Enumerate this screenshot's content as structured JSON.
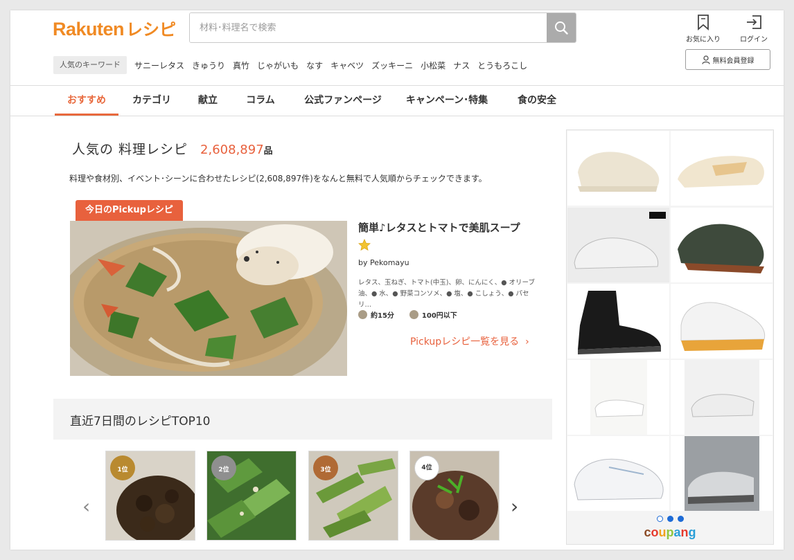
{
  "header": {
    "logo_brand": "Rakuten",
    "logo_suffix": "レシピ",
    "search_placeholder": "材料･料理名で検索",
    "favorites_label": "お気に入り",
    "login_label": "ログイン",
    "register_label": "無料会員登録"
  },
  "keywords": {
    "label": "人気のキーワード",
    "items": [
      "サニーレタス",
      "きゅうり",
      "真竹",
      "じゃがいも",
      "なす",
      "キャベツ",
      "ズッキーニ",
      "小松菜",
      "ナス",
      "とうもろこし"
    ]
  },
  "nav": {
    "tabs": [
      "おすすめ",
      "カテゴリ",
      "献立",
      "コラム",
      "公式ファンページ",
      "キャンペーン･特集",
      "食の安全"
    ],
    "active_index": 0
  },
  "main": {
    "title": "人気の 料理レシピ",
    "count": "2,608,897",
    "count_unit": "品",
    "description": "料理や食材別、イベント･シーンに合わせたレシピ(2,608,897件)をなんと無料で人気順からチェックできます。"
  },
  "pickup": {
    "badge": "今日のPickupレシピ",
    "title": "簡単♪レタスとトマトで美肌スープ",
    "title_icon": "star-icon",
    "author": "by Pekomayu",
    "ingredients": "レタス、玉ねぎ、トマト(中玉)、卵、にんにく、● オリーブ油、● 水、● 野菜コンソメ、● 塩、● こしょう、● パセリ…",
    "time": "約15分",
    "cost": "100円以下",
    "link": "Pickupレシピ一覧を見る"
  },
  "top10": {
    "title": "直近7日間のレシピTOP10",
    "cards": [
      {
        "rank": "1位",
        "color": "#b98a30"
      },
      {
        "rank": "2位",
        "color": "#8f8f8f"
      },
      {
        "rank": "3位",
        "color": "#b06a35"
      },
      {
        "rank": "4位",
        "color": "#ffffff"
      }
    ]
  },
  "ad": {
    "brand": "coupang"
  },
  "colors": {
    "accent": "#e8613d",
    "logo": "#f08a24",
    "ad_blue": "#1e6bd6"
  }
}
